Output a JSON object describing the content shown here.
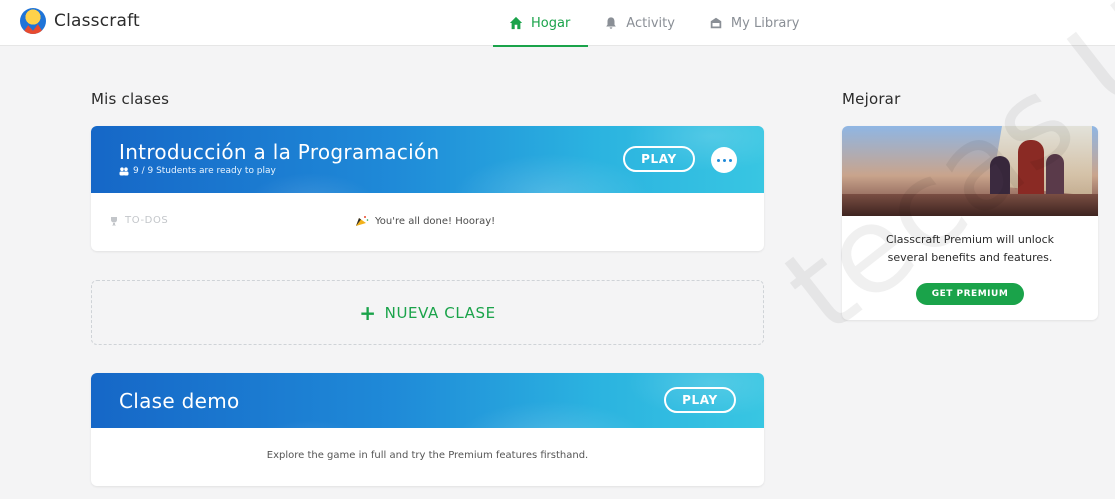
{
  "app": {
    "name": "Classcraft"
  },
  "nav": {
    "items": [
      {
        "label": "Hogar",
        "icon": "home-icon",
        "active": true
      },
      {
        "label": "Activity",
        "icon": "bell-icon",
        "active": false
      },
      {
        "label": "My Library",
        "icon": "library-icon",
        "active": false
      }
    ]
  },
  "classes_section": {
    "title": "Mis clases"
  },
  "class_card": {
    "title": "Introducción a la Programación",
    "students_ready": "9 / 9 Students are ready to play",
    "play_label": "PLAY",
    "todos_label": "TO-DOS",
    "done_message": "You're all done! Hooray!"
  },
  "new_class": {
    "label": "NUEVA CLASE"
  },
  "demo_card": {
    "title": "Clase demo",
    "play_label": "PLAY",
    "description": "Explore the game in full and try the Premium features firsthand."
  },
  "upgrade_section": {
    "title": "Mejorar"
  },
  "premium": {
    "line1": "Classcraft Premium will unlock",
    "line2": "several benefits and features.",
    "button_label": "GET PREMIUM"
  },
  "watermark": {
    "text": "tecas UA"
  },
  "colors": {
    "accent_green": "#1aa34a",
    "banner_blue": "#1f8ad8",
    "muted": "#c3c6ca"
  }
}
